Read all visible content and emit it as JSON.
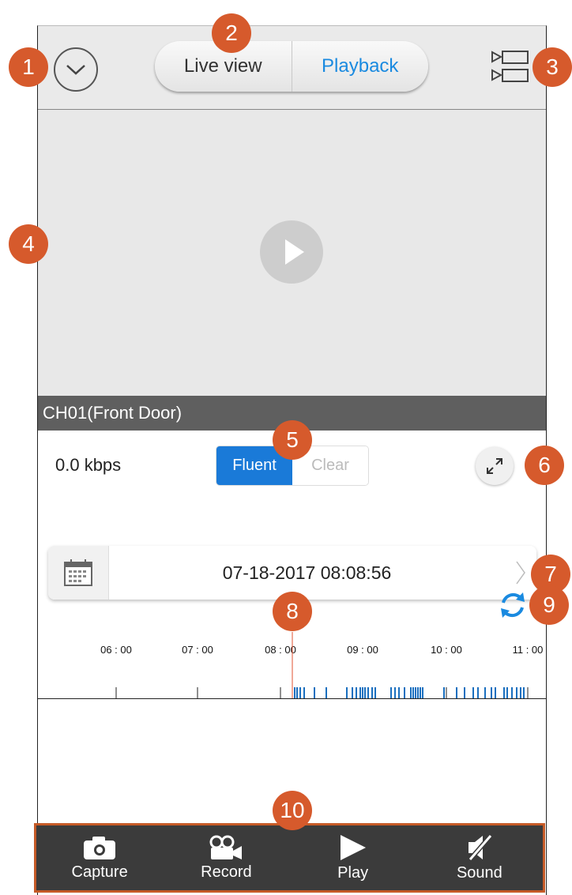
{
  "header": {
    "tabs": [
      {
        "label": "Live view",
        "active": false
      },
      {
        "label": "Playback",
        "active": true
      }
    ]
  },
  "video": {
    "channel_label": "CH01(Front Door)"
  },
  "stream": {
    "bitrate": "0.0 kbps",
    "quality_options": [
      "Fluent",
      "Clear"
    ],
    "selected_quality": "Fluent"
  },
  "date_selector": {
    "datetime": "07-18-2017 08:08:56"
  },
  "timeline": {
    "ticks": [
      "06 : 00",
      "07 : 00",
      "08 : 00",
      "09 : 00",
      "10 : 00",
      "11 : 00"
    ]
  },
  "toolbar": {
    "capture_label": "Capture",
    "record_label": "Record",
    "play_label": "Play",
    "sound_label": "Sound"
  },
  "callouts": [
    "1",
    "2",
    "3",
    "4",
    "5",
    "6",
    "7",
    "8",
    "9",
    "10"
  ],
  "colors": {
    "accent_blue": "#1a7ad8",
    "callout_orange": "#d65a2c",
    "toolbar_bg": "#3b3b3b"
  }
}
